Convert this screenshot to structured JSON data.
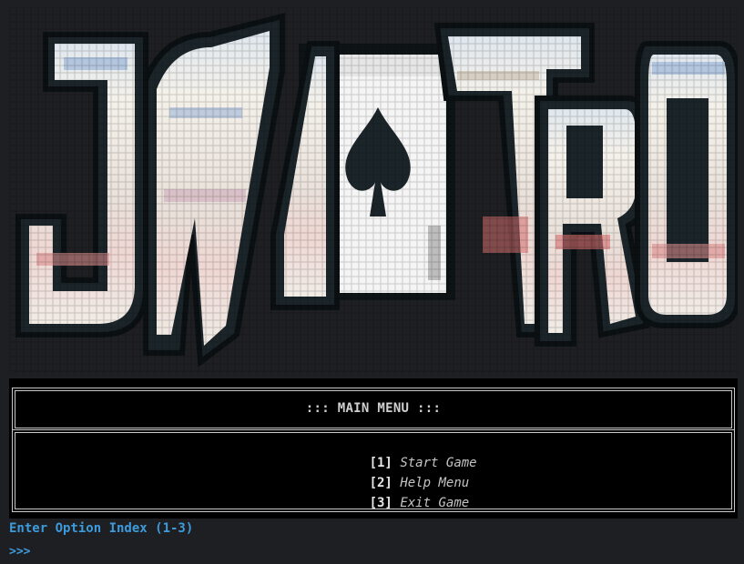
{
  "logo": {
    "text": "JALATRO",
    "emblem": "spade-card-icon"
  },
  "menu": {
    "title": "::: MAIN MENU :::",
    "options": [
      {
        "index": "[1]",
        "label": "Start Game"
      },
      {
        "index": "[2]",
        "label": "Help Menu"
      },
      {
        "index": "[3]",
        "label": "Exit Game"
      }
    ]
  },
  "prompt": {
    "label": "Enter Option Index (1-3)",
    "symbol": ">>>"
  },
  "colors": {
    "background": "#1e1f22",
    "menu_background": "#000000",
    "prompt": "#3d9bdc",
    "logo_fill": "#f2efe8",
    "logo_outline": "#1b2529"
  }
}
